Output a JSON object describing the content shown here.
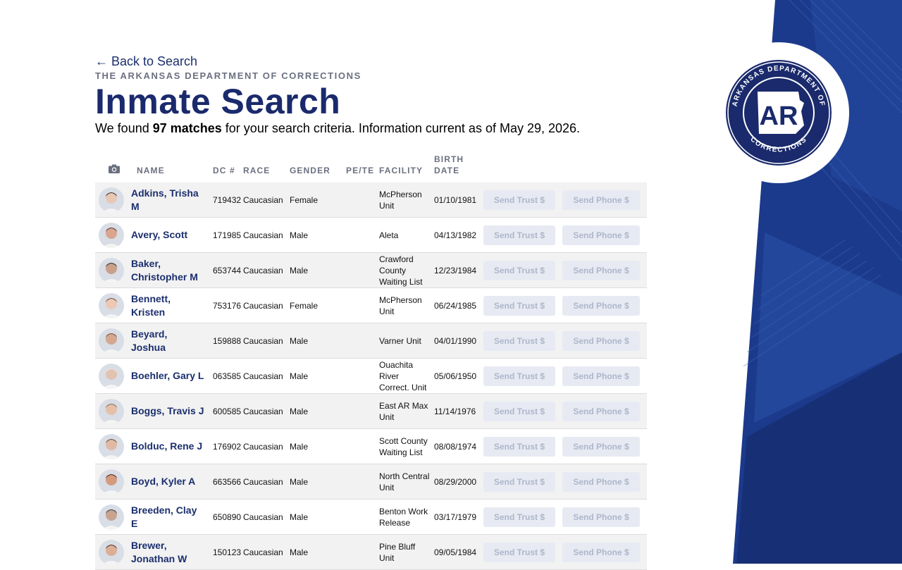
{
  "back_link": "← Back to Search",
  "department": "THE ARKANSAS DEPARTMENT OF CORRECTIONS",
  "title": "Inmate Search",
  "summary": {
    "prefix": "We found ",
    "count": "97 matches",
    "suffix": " for your search criteria. Information current as of May 29, 2026."
  },
  "seal": {
    "top_text": "ARKANSAS DEPARTMENT OF",
    "bottom_text": "CORRECTIONS",
    "monogram": "AR"
  },
  "colors": {
    "navy": "#1a2a6c",
    "panel_blue": "#1c3a8c",
    "button_bg": "#e7eaf2",
    "button_text": "#aeb6cc"
  },
  "table": {
    "headers": {
      "photo": "camera-icon",
      "name": "NAME",
      "dc": "DC #",
      "race": "RACE",
      "gender": "GENDER",
      "pete": "PE/TE",
      "facility": "FACILITY",
      "birth": "BIRTH DATE"
    },
    "trust_label": "Send Trust $",
    "phone_label": "Send Phone $",
    "rows": [
      {
        "name": "Adkins, Trisha M",
        "dc": "719432",
        "race": "Caucasian",
        "gender": "Female",
        "pete": "",
        "facility": "McPherson Unit",
        "birth": "01/10/1981",
        "skin": "#e8c8b4",
        "hair": "#3a2a22"
      },
      {
        "name": "Avery, Scott",
        "dc": "171985",
        "race": "Caucasian",
        "gender": "Male",
        "pete": "",
        "facility": "Aleta",
        "birth": "04/13/1982",
        "skin": "#d9a58f",
        "hair": "#5a3a2a"
      },
      {
        "name": "Baker, Christopher M",
        "dc": "653744",
        "race": "Caucasian",
        "gender": "Male",
        "pete": "",
        "facility": "Crawford County Waiting List",
        "birth": "12/23/1984",
        "skin": "#c9a08a",
        "hair": "#3c2c24"
      },
      {
        "name": "Bennett, Kristen",
        "dc": "753176",
        "race": "Caucasian",
        "gender": "Female",
        "pete": "",
        "facility": "McPherson Unit",
        "birth": "06/24/1985",
        "skin": "#edc9b5",
        "hair": "#6b4a32"
      },
      {
        "name": "Beyard, Joshua",
        "dc": "159888",
        "race": "Caucasian",
        "gender": "Male",
        "pete": "",
        "facility": "Varner Unit",
        "birth": "04/01/1990",
        "skin": "#d4a890",
        "hair": "#7a4e34"
      },
      {
        "name": "Boehler, Gary L",
        "dc": "063585",
        "race": "Caucasian",
        "gender": "Male",
        "pete": "",
        "facility": "Ouachita River Correct. Unit",
        "birth": "05/06/1950",
        "skin": "#e2c3b0",
        "hair": "#e8e8e8"
      },
      {
        "name": "Boggs, Travis J",
        "dc": "600585",
        "race": "Caucasian",
        "gender": "Male",
        "pete": "",
        "facility": "East AR Max Unit",
        "birth": "11/14/1976",
        "skin": "#e5c0a8",
        "hair": "#8a6a4a"
      },
      {
        "name": "Bolduc, Rene J",
        "dc": "176902",
        "race": "Caucasian",
        "gender": "Male",
        "pete": "",
        "facility": "Scott County Waiting List",
        "birth": "08/08/1974",
        "skin": "#e0b9a4",
        "hair": "#6b5038"
      },
      {
        "name": "Boyd, Kyler A",
        "dc": "663566",
        "race": "Caucasian",
        "gender": "Male",
        "pete": "",
        "facility": "North Central Unit",
        "birth": "08/29/2000",
        "skin": "#d49a80",
        "hair": "#4a2a1c"
      },
      {
        "name": "Breeden, Clay E",
        "dc": "650890",
        "race": "Caucasian",
        "gender": "Male",
        "pete": "",
        "facility": "Benton Work Release",
        "birth": "03/17/1979",
        "skin": "#c8a490",
        "hair": "#3a3a3a"
      },
      {
        "name": "Brewer, Jonathan W",
        "dc": "150123",
        "race": "Caucasian",
        "gender": "Male",
        "pete": "",
        "facility": "Pine Bluff Unit",
        "birth": "09/05/1984",
        "skin": "#dcae96",
        "hair": "#4a3426"
      }
    ]
  }
}
